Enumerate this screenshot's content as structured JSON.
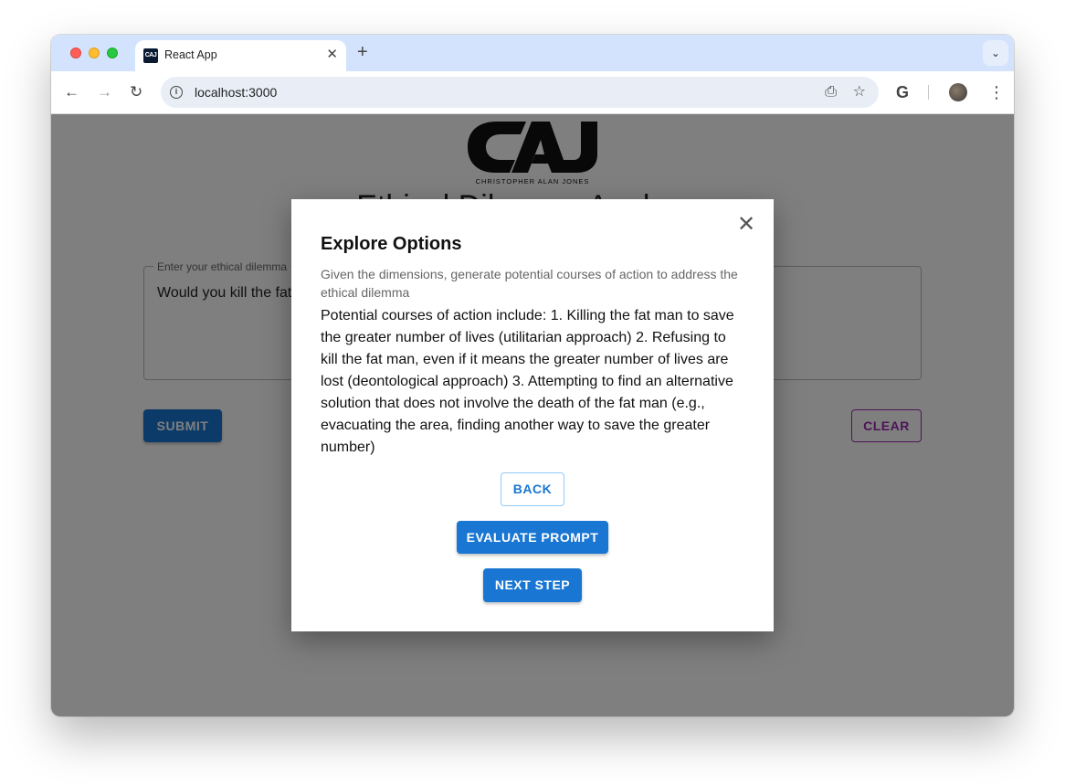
{
  "browser": {
    "tab_title": "React App",
    "tab_favicon_text": "CAJ",
    "tab_close": "✕",
    "new_tab": "+",
    "tab_menu": "⌄",
    "url": "localhost:3000",
    "icons": {
      "back": "←",
      "forward": "→",
      "reload": "↻",
      "info": "i",
      "install": "⎙",
      "star": "☆",
      "google": "G",
      "menu": "⋮"
    }
  },
  "page": {
    "logo": {
      "text": "CAJ",
      "subtitle": "CHRISTOPHER ALAN JONES"
    },
    "title": "Ethical Dilemma Analyzer",
    "dilemma_label": "Enter your ethical dilemma",
    "dilemma_text": "Would you kill the fat man?",
    "submit_label": "SUBMIT",
    "clear_label": "CLEAR"
  },
  "modal": {
    "close": "✕",
    "title": "Explore Options",
    "subtitle": "Given the dimensions, generate potential courses of action to address the ethical dilemma",
    "body": "Potential courses of action include: 1. Killing the fat man to save the greater number of lives (utilitarian approach) 2. Refusing to kill the fat man, even if it means the greater number of lives are lost (deontological approach) 3. Attempting to find an alternative solution that does not involve the death of the fat man (e.g., evacuating the area, finding another way to save the greater number)",
    "back_label": "BACK",
    "evaluate_label": "EVALUATE PROMPT",
    "next_label": "NEXT STEP"
  },
  "colors": {
    "primary": "#1976d2",
    "secondary": "#9c27b0",
    "backdrop": "rgba(0,0,0,0.5)",
    "tabbar": "#d3e3fd"
  }
}
